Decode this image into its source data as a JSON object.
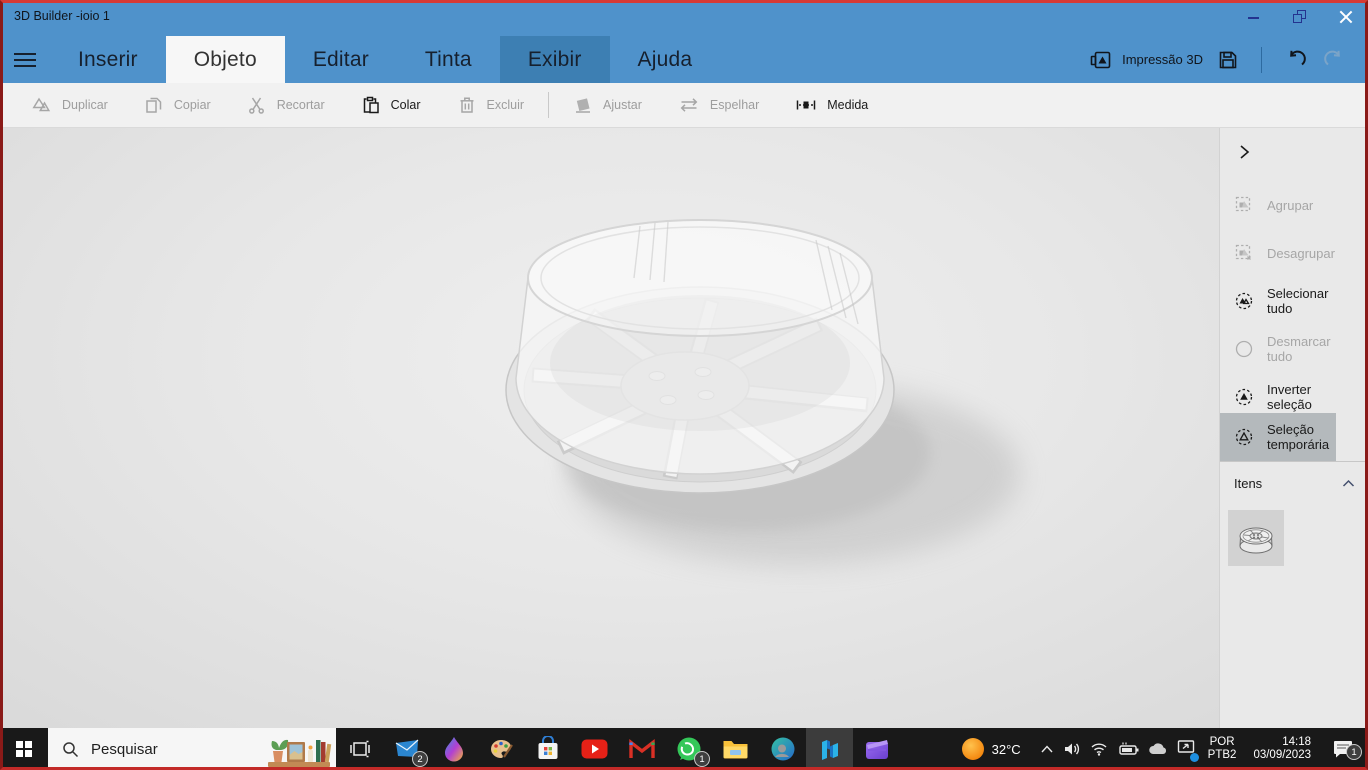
{
  "colors": {
    "accent": "#4f92cb",
    "tab_hover": "#3d7fb3",
    "ribbon_bg": "#f1f1f1",
    "sidebar_bg": "#e9e9e9",
    "selection_bg": "#b4b9bc",
    "taskbar_bg": "#191919",
    "frame_top": "#d63a35",
    "frame_bottom": "#c32a28",
    "frame_side": "#8a1a18",
    "indicator": "#9db4c6"
  },
  "window": {
    "title": "3D Builder -ioio 1"
  },
  "menu": {
    "tabs": [
      {
        "label": "Inserir"
      },
      {
        "label": "Objeto",
        "state": "selected"
      },
      {
        "label": "Editar"
      },
      {
        "label": "Tinta"
      },
      {
        "label": "Exibir",
        "state": "hover"
      },
      {
        "label": "Ajuda"
      }
    ],
    "print_label": "Impressão 3D"
  },
  "toolbar": {
    "items": [
      {
        "label": "Duplicar",
        "enabled": false
      },
      {
        "label": "Copiar",
        "enabled": false
      },
      {
        "label": "Recortar",
        "enabled": false
      },
      {
        "label": "Colar",
        "enabled": true
      },
      {
        "label": "Excluir",
        "enabled": false
      },
      {
        "label": "Ajustar",
        "enabled": false
      },
      {
        "label": "Espelhar",
        "enabled": false
      },
      {
        "label": "Medida",
        "enabled": true
      }
    ]
  },
  "canvas": {
    "model": "filament-spool"
  },
  "sidebar": {
    "items": [
      {
        "label": "Agrupar",
        "enabled": false
      },
      {
        "label": "Desagrupar",
        "enabled": false
      },
      {
        "label": "Selecionar tudo",
        "enabled": true
      },
      {
        "label": "Desmarcar tudo",
        "enabled": false
      },
      {
        "label": "Inverter seleção",
        "enabled": true
      },
      {
        "label": "Seleção temporária",
        "enabled": true,
        "selected": true
      }
    ],
    "items_header": "Itens"
  },
  "taskbar": {
    "search_placeholder": "Pesquisar",
    "badges": {
      "mail": "2",
      "whatsapp": "1",
      "notifications": "1"
    },
    "weather": {
      "temp": "32°C"
    },
    "language": {
      "line1": "POR",
      "line2": "PTB2"
    },
    "clock": {
      "time": "14:18",
      "date": "03/09/2023"
    }
  }
}
